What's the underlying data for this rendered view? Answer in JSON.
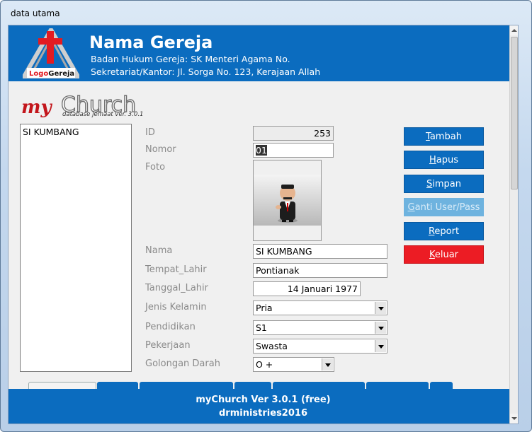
{
  "window": {
    "title": "data utama"
  },
  "header": {
    "church_name": "Nama Gereja",
    "line1": "Badan Hukum Gereja: SK Menteri Agama No.",
    "line2": "Sekretariat/Kantor: Jl. Sorga No. 123, Kerajaan Allah",
    "logo_text_1": "Logo",
    "logo_text_2": "Gereja"
  },
  "brand": {
    "my": "my",
    "church": "Church",
    "subtitle": "database jemaat ver. 3.0.1"
  },
  "members": [
    "SI KUMBANG"
  ],
  "form": {
    "id_label": "ID",
    "id_value": "253",
    "nomor_label": "Nomor",
    "nomor_value": "01",
    "foto_label": "Foto",
    "nama_label": "Nama",
    "nama_value": "SI KUMBANG",
    "tempat_label": "Tempat_Lahir",
    "tempat_value": "Pontianak",
    "tanggal_label": "Tanggal_Lahir",
    "tanggal_value": "14 Januari 1977",
    "jk_label": "Jenis Kelamin",
    "jk_value": "Pria",
    "pendidikan_label": "Pendidikan",
    "pendidikan_value": "S1",
    "pekerjaan_label": "Pekerjaan",
    "pekerjaan_value": "Swasta",
    "goldar_label": "Golongan Darah",
    "goldar_value": "O +"
  },
  "buttons": {
    "tambah": {
      "access": "T",
      "rest": "ambah"
    },
    "hapus": {
      "access": "H",
      "rest": "apus"
    },
    "simpan": {
      "access": "S",
      "rest": "impan"
    },
    "ganti": {
      "access": "G",
      "rest": "anti User/Pass"
    },
    "report": {
      "access": "R",
      "rest": "eport"
    },
    "keluar": {
      "access": "K",
      "rest": "eluar"
    }
  },
  "footer": {
    "line1": "myChurch Ver 3.0.1 (free)",
    "line2": "drministries2016"
  },
  "colors": {
    "primary": "#0b6cbf",
    "danger": "#ec1c24",
    "disabled": "#6eb3df"
  }
}
